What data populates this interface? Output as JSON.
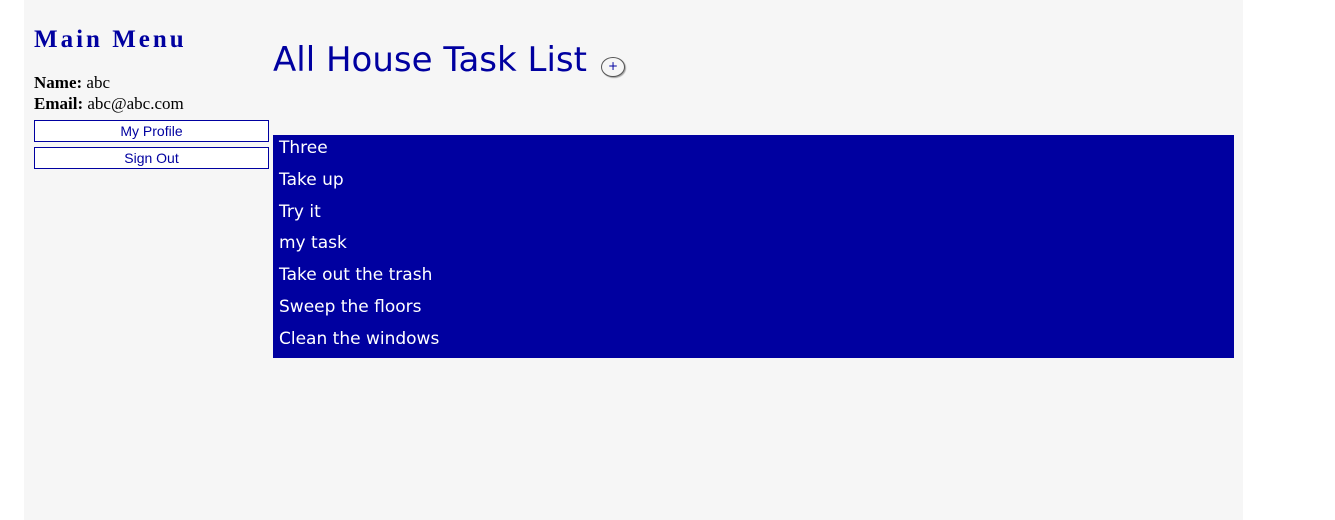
{
  "sidebar": {
    "title": "Main Menu",
    "name_label": "Name:",
    "name_value": "abc",
    "email_label": "Email:",
    "email_value": "abc@abc.com",
    "profile_button": "My Profile",
    "signout_button": "Sign Out"
  },
  "main": {
    "title": "All House Task List",
    "add_button": "+",
    "tasks": [
      "Three",
      "Take up",
      "Try it",
      "my task",
      "Take out the trash",
      "Sweep the floors",
      "Clean the windows"
    ]
  },
  "colors": {
    "accent": "#0000a0",
    "background": "#f6f6f6"
  }
}
